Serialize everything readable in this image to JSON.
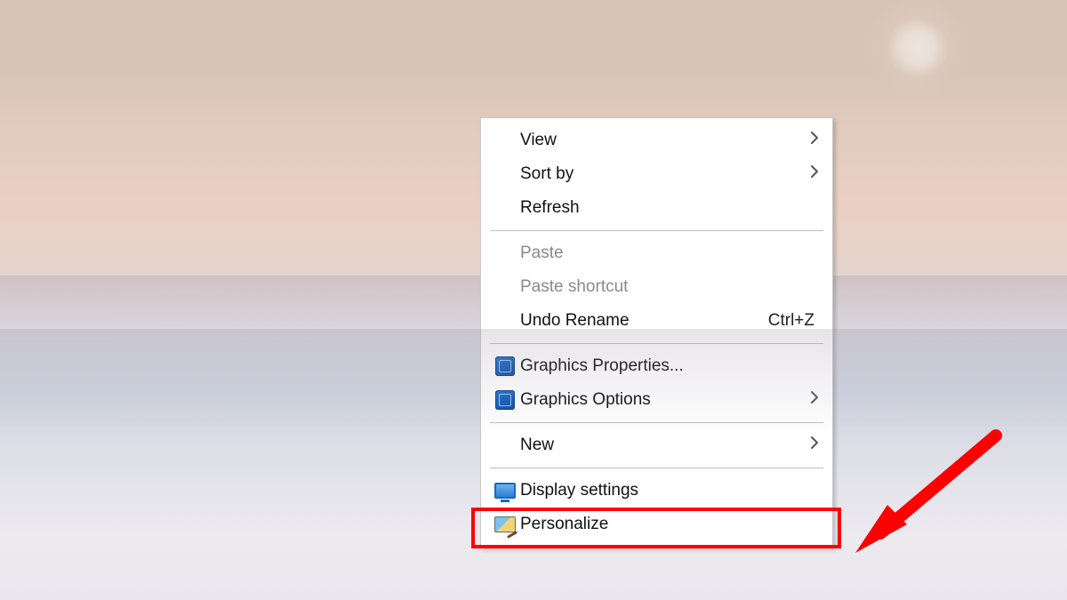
{
  "context_menu": {
    "items": [
      {
        "label": "View",
        "has_submenu": true,
        "enabled": true,
        "icon": null,
        "shortcut": null
      },
      {
        "label": "Sort by",
        "has_submenu": true,
        "enabled": true,
        "icon": null,
        "shortcut": null
      },
      {
        "label": "Refresh",
        "has_submenu": false,
        "enabled": true,
        "icon": null,
        "shortcut": null
      },
      {
        "separator": true
      },
      {
        "label": "Paste",
        "has_submenu": false,
        "enabled": false,
        "icon": null,
        "shortcut": null
      },
      {
        "label": "Paste shortcut",
        "has_submenu": false,
        "enabled": false,
        "icon": null,
        "shortcut": null
      },
      {
        "label": "Undo Rename",
        "has_submenu": false,
        "enabled": true,
        "icon": null,
        "shortcut": "Ctrl+Z"
      },
      {
        "separator": true
      },
      {
        "label": "Graphics Properties...",
        "has_submenu": false,
        "enabled": true,
        "icon": "intel-icon",
        "shortcut": null
      },
      {
        "label": "Graphics Options",
        "has_submenu": true,
        "enabled": true,
        "icon": "intel-icon",
        "shortcut": null
      },
      {
        "separator": true
      },
      {
        "label": "New",
        "has_submenu": true,
        "enabled": true,
        "icon": null,
        "shortcut": null
      },
      {
        "separator": true
      },
      {
        "label": "Display settings",
        "has_submenu": false,
        "enabled": true,
        "icon": "display-icon",
        "shortcut": null,
        "highlighted": true
      },
      {
        "label": "Personalize",
        "has_submenu": false,
        "enabled": true,
        "icon": "personalize-icon",
        "shortcut": null
      }
    ]
  },
  "annotation": {
    "highlight_target": "Display settings",
    "highlight_color": "#ff0000",
    "arrow_color": "#ff0000"
  }
}
